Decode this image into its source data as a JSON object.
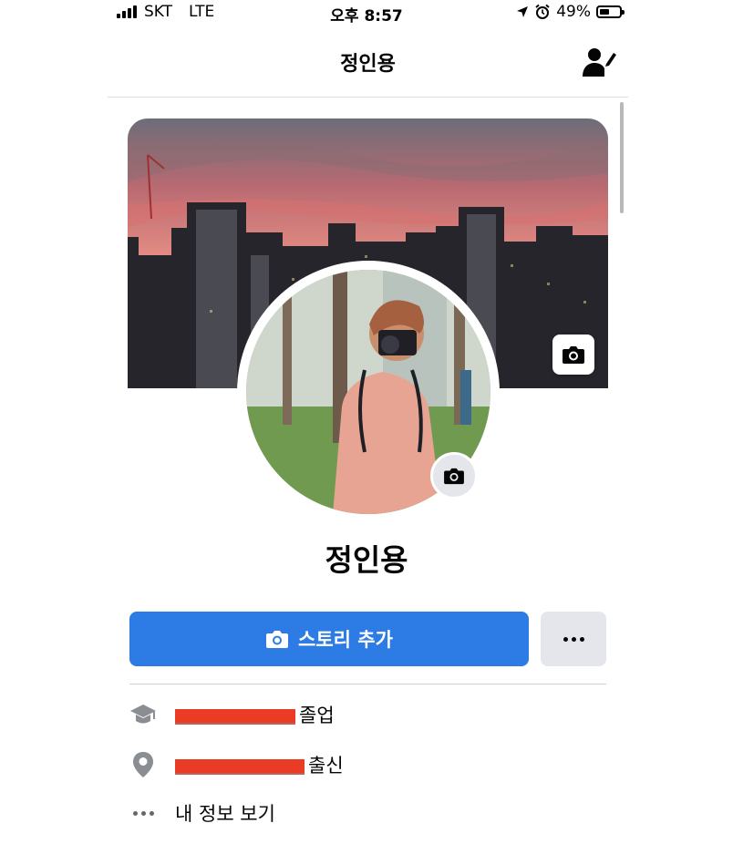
{
  "status_bar": {
    "carrier": "SKT",
    "network": "LTE",
    "time": "오후 8:57",
    "battery_percent": "49%",
    "battery_level": 0.49
  },
  "header": {
    "title": "정인용",
    "edit_icon": "person-edit-icon"
  },
  "profile": {
    "name": "정인용",
    "cover_camera_icon": "camera-icon",
    "avatar_camera_icon": "camera-icon"
  },
  "actions": {
    "add_story_label": "스토리 추가",
    "add_story_icon": "camera-icon",
    "more_icon": "more-dots-icon",
    "accent_color": "#2d7be4"
  },
  "info": [
    {
      "icon": "graduation-cap-icon",
      "suffix": "졸업"
    },
    {
      "icon": "location-pin-icon",
      "suffix": "출신"
    },
    {
      "icon": "more-dots-icon",
      "label": "내 정보 보기"
    }
  ]
}
